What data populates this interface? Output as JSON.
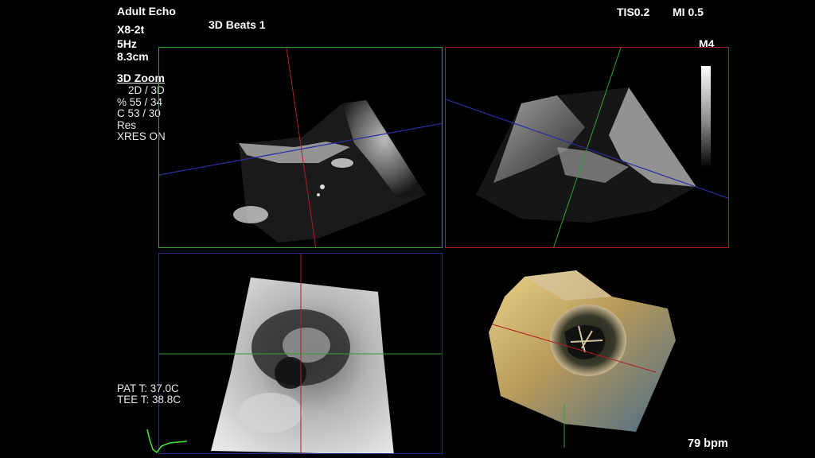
{
  "header": {
    "preset": "Adult Echo",
    "probe": "X8-2t",
    "frequency": "5Hz",
    "depth": "8.3cm",
    "mode_title": "3D Beats 1",
    "tis": "TIS0.2",
    "mi": "MI 0.5",
    "map_label": "M4"
  },
  "zoom_panel": {
    "title": "3D Zoom",
    "lines": [
      "2D / 3D",
      "% 55 / 34",
      "C  53 / 30",
      "Res",
      "XRES ON"
    ]
  },
  "temps": {
    "pat": "PAT T: 37.0C",
    "tee": "TEE T: 38.8C"
  },
  "heart_rate": "79 bpm",
  "colors": {
    "plane_green": "#2ba52b",
    "plane_red": "#b01f1f",
    "plane_blue": "#1f2f8a",
    "ecg": "#39e639"
  }
}
